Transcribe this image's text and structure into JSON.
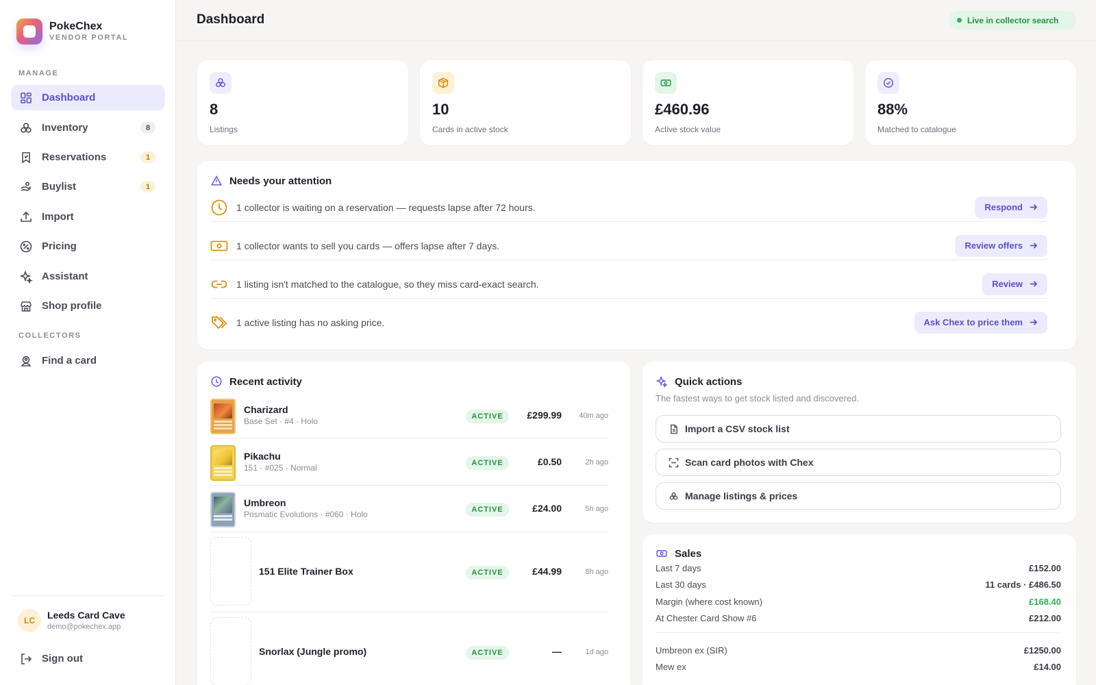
{
  "brand": {
    "name": "PokeChex",
    "subtitle": "VENDOR PORTAL"
  },
  "sidebar": {
    "sections": {
      "manage": "MANAGE",
      "collectors": "COLLECTORS"
    },
    "items": [
      {
        "label": "Dashboard",
        "icon": "grid-icon",
        "active": true
      },
      {
        "label": "Inventory",
        "icon": "cards-icon",
        "badge": "8"
      },
      {
        "label": "Reservations",
        "icon": "bookmark-icon",
        "badge": "1"
      },
      {
        "label": "Buylist",
        "icon": "hand-icon",
        "badge": "1"
      },
      {
        "label": "Import",
        "icon": "upload-icon"
      },
      {
        "label": "Pricing",
        "icon": "percent-icon"
      },
      {
        "label": "Assistant",
        "icon": "sparkle-icon"
      },
      {
        "label": "Shop profile",
        "icon": "store-icon"
      },
      {
        "label": "Find a card",
        "icon": "user-search-icon"
      }
    ],
    "user": {
      "initials": "LC",
      "name": "Leeds Card Cave",
      "email": "demo@pokechex.app"
    },
    "sign_out": "Sign out"
  },
  "header": {
    "title": "Dashboard",
    "status": "Live in collector search"
  },
  "stats": [
    {
      "value": "8",
      "label": "Listings",
      "icon": "cards-icon",
      "color": "#6b5ce0",
      "bg": "#efedfd"
    },
    {
      "value": "10",
      "label": "Cards in active stock",
      "icon": "box-icon",
      "color": "#d4930f",
      "bg": "#fdf1d8"
    },
    {
      "value": "£460.96",
      "label": "Active stock value",
      "icon": "cash-icon",
      "color": "#2fa052",
      "bg": "#e3f6e8"
    },
    {
      "value": "88%",
      "label": "Matched to catalogue",
      "icon": "check-circle-icon",
      "color": "#6b5ce0",
      "bg": "#efedfd"
    }
  ],
  "attention": {
    "title": "Needs your attention",
    "items": [
      {
        "text": "1 collector is waiting on a reservation — requests lapse after 72 hours.",
        "button": "Respond",
        "icon": "clock-icon"
      },
      {
        "text": "1 collector wants to sell you cards — offers lapse after 7 days.",
        "button": "Review offers",
        "icon": "cash-icon"
      },
      {
        "text": "1 listing isn't matched to the catalogue, so they miss card-exact search.",
        "button": "Review",
        "icon": "link-icon"
      },
      {
        "text": "1 active listing has no asking price.",
        "button": "Ask Chex to price them",
        "icon": "tag-icon"
      }
    ]
  },
  "activity": {
    "title": "Recent activity",
    "rows": [
      {
        "name": "Charizard",
        "sub": "Base Set · #4 · Holo",
        "status": "ACTIVE",
        "price": "£299.99",
        "time": "40m ago"
      },
      {
        "name": "Pikachu",
        "sub": "151 · #025 · Normal",
        "status": "ACTIVE",
        "price": "£0.50",
        "time": "2h ago"
      },
      {
        "name": "Umbreon",
        "sub": "Prismatic Evolutions · #060 · Holo",
        "status": "ACTIVE",
        "price": "£24.00",
        "time": "5h ago"
      },
      {
        "name": "151 Elite Trainer Box",
        "sub": "",
        "status": "ACTIVE",
        "price": "£44.99",
        "time": "8h ago"
      },
      {
        "name": "Snorlax (Jungle promo)",
        "sub": "",
        "status": "ACTIVE",
        "price": "—",
        "time": "1d ago"
      }
    ]
  },
  "quick_actions": {
    "title": "Quick actions",
    "subtitle": "The fastest ways to get stock listed and discovered.",
    "buttons": [
      {
        "label": "Import a CSV stock list",
        "icon": "file-icon"
      },
      {
        "label": "Scan card photos with Chex",
        "icon": "scan-icon"
      },
      {
        "label": "Manage listings & prices",
        "icon": "cards-icon"
      }
    ]
  },
  "sales": {
    "title": "Sales",
    "rows": [
      {
        "label": "Last 7 days",
        "value": "£152.00"
      },
      {
        "label": "Last 30 days",
        "value": "11 cards · £486.50"
      },
      {
        "label": "Margin (where cost known)",
        "value": "£168.40"
      },
      {
        "label": "At Chester Card Show #6",
        "value": "£212.00"
      }
    ],
    "top": [
      {
        "label": "Umbreon ex (SIR)",
        "value": "£1250.00"
      },
      {
        "label": "Mew ex",
        "value": "£14.00"
      }
    ]
  }
}
